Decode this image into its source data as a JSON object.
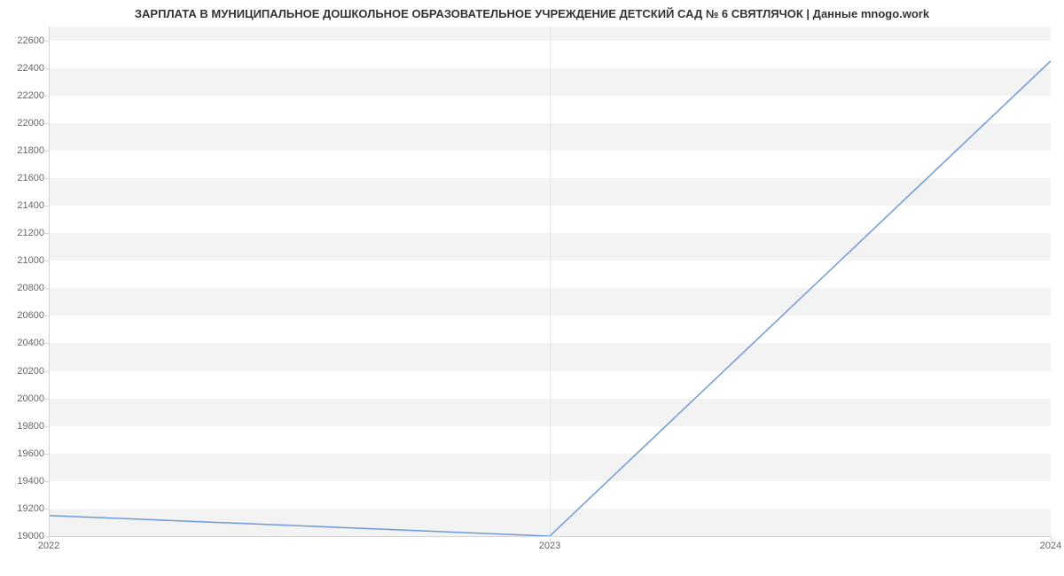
{
  "chart_data": {
    "type": "line",
    "title": "ЗАРПЛАТА В МУНИЦИПАЛЬНОЕ ДОШКОЛЬНОЕ ОБРАЗОВАТЕЛЬНОЕ УЧРЕЖДЕНИЕ ДЕТСКИЙ САД № 6 СВЯТЛЯЧОК | Данные mnogo.work",
    "xlabel": "",
    "ylabel": "",
    "x": [
      2022,
      2023,
      2024
    ],
    "values": [
      19150,
      19000,
      22450
    ],
    "x_ticks": [
      2022,
      2023,
      2024
    ],
    "y_ticks": [
      19000,
      19200,
      19400,
      19600,
      19800,
      20000,
      20200,
      20400,
      20600,
      20800,
      21000,
      21200,
      21400,
      21600,
      21800,
      22000,
      22200,
      22400,
      22600
    ],
    "ylim": [
      19000,
      22700
    ],
    "xlim": [
      2022,
      2024
    ],
    "series_color": "#6f9bd8",
    "grid": {
      "horizontal_bands": true,
      "vertical_lines": true
    }
  }
}
